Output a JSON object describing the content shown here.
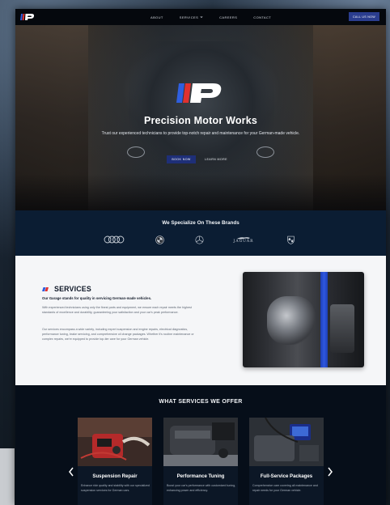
{
  "nav": {
    "logo": "p-logo-icon",
    "links": [
      {
        "label": "ABOUT"
      },
      {
        "label": "SERVICES"
      },
      {
        "label": "CAREERS"
      },
      {
        "label": "CONTACT"
      }
    ],
    "cta_label": "CALL US NOW"
  },
  "hero": {
    "title": "Precision Motor Works",
    "subtitle": "Trust our experienced technicians to provide top-notch repair and maintenance for your German-made vehicle.",
    "primary_button": "BOOK NOW",
    "secondary_button": "LEARN MORE"
  },
  "brands": {
    "title": "We Specialize On These Brands",
    "items": [
      {
        "icon": "audi-logo-icon"
      },
      {
        "icon": "bmw-logo-icon"
      },
      {
        "icon": "mercedes-logo-icon"
      },
      {
        "icon": "jaguar-logo-icon",
        "text": "JAGUAR"
      },
      {
        "icon": "porsche-logo-icon"
      }
    ]
  },
  "services": {
    "heading": "SERVICES",
    "lead": "Our Garage stands for quality in servicing German-made vehicles.",
    "paragraph1": "With experienced technicians using only the finest parts and equipment, we ensure each repair meets the highest standards of excellence and durability, guaranteeing your satisfaction and your car's peak performance.",
    "paragraph2": "Our services encompass a wide variety, including expert suspension and engine repairs, electrical diagnostics, performance tuning, brake servicing, and comprehensive oil change packages. Whether it's routine maintenance or complex repairs, we're equipped to provide top-tier care for your German vehicle."
  },
  "offers": {
    "title": "WHAT SERVICES WE OFFER",
    "cards": [
      {
        "title": "Suspension Repair",
        "text": "Enhance ride quality and stability with our specialized suspension services for German cars."
      },
      {
        "title": "Performance Tuning",
        "text": "Boost your car's performance with customized tuning, enhancing power and efficiency."
      },
      {
        "title": "Full-Service Packages",
        "text": "Comprehensive care covering all maintenance and repair needs for your German vehicle."
      }
    ]
  },
  "colors": {
    "accent_blue": "#1e2f78",
    "brand_blue_band": "#0b1d33",
    "logo_red": "#e0312f",
    "logo_blue": "#2f5fe0"
  }
}
